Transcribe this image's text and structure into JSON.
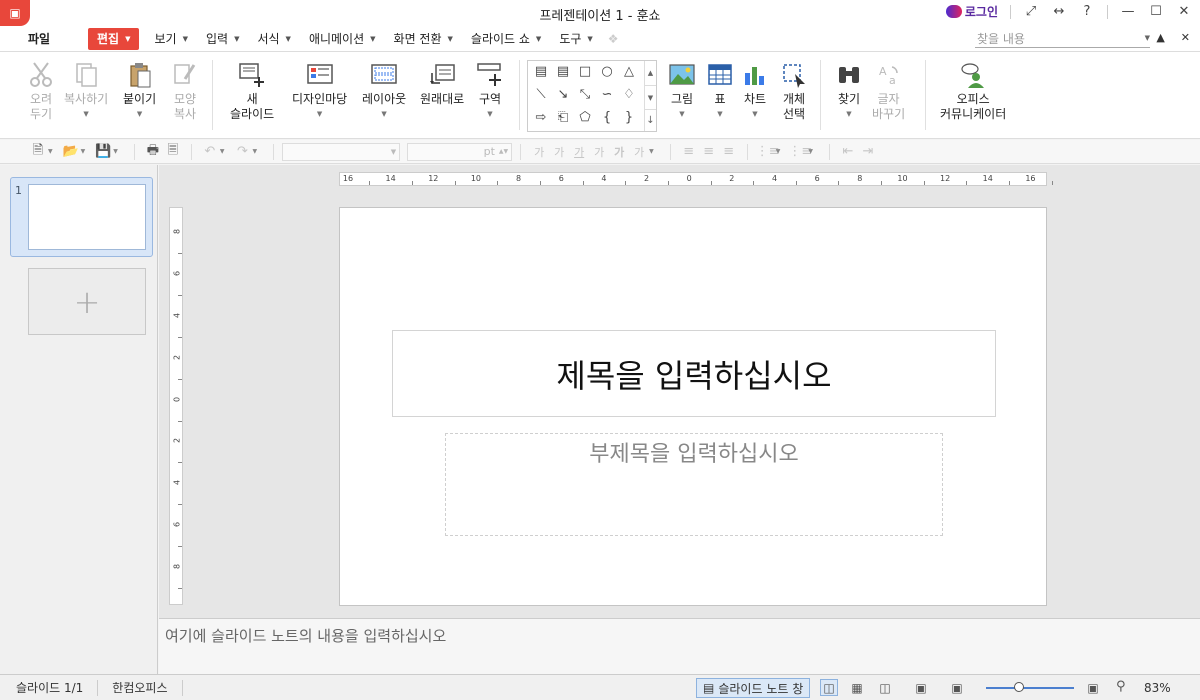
{
  "window": {
    "title": "프레젠테이션 1 - 훈쇼",
    "login": "로그인"
  },
  "menu": {
    "file": "파일",
    "items": [
      {
        "label": "편집",
        "active": true
      },
      {
        "label": "보기"
      },
      {
        "label": "입력"
      },
      {
        "label": "서식"
      },
      {
        "label": "애니메이션"
      },
      {
        "label": "화면 전환"
      },
      {
        "label": "슬라이드 쇼"
      },
      {
        "label": "도구"
      }
    ],
    "search_placeholder": "찾을 내용"
  },
  "ribbon": {
    "cut": "오려\n두기",
    "copy": "복사하기",
    "paste": "붙이기",
    "format_copy": "모양\n복사",
    "new_slide": "새\n슬라이드",
    "design": "디자인마당",
    "layout": "레이아웃",
    "reset": "원래대로",
    "section": "구역",
    "picture": "그림",
    "table": "표",
    "chart": "차트",
    "select_object": "개체\n선택",
    "find": "찾기",
    "replace": "글자\n바꾸기",
    "communicator": "오피스\n커뮤니케이터"
  },
  "toolbar": {
    "font_size_unit": "pt"
  },
  "slides": [
    {
      "number": "1"
    }
  ],
  "slide": {
    "title_placeholder": "제목을 입력하십시오",
    "subtitle_placeholder": "부제목을 입력하십시오"
  },
  "ruler": {
    "h_ticks": [
      "16",
      "14",
      "12",
      "10",
      "8",
      "6",
      "4",
      "2",
      "0",
      "2",
      "4",
      "6",
      "8",
      "10",
      "12",
      "14",
      "16"
    ],
    "v_ticks": [
      "8",
      "6",
      "4",
      "2",
      "0",
      "2",
      "4",
      "6",
      "8"
    ]
  },
  "notes_placeholder": "여기에 슬라이드 노트의 내용을 입력하십시오",
  "status": {
    "slide_count": "슬라이드 1/1",
    "app_name": "한컴오피스",
    "notes_pane": "슬라이드 노트 창",
    "zoom": "83%",
    "zoom_fraction": 0.38
  }
}
